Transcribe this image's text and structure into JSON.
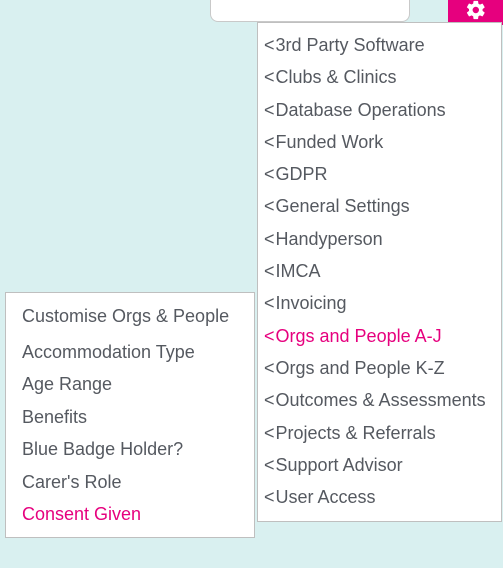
{
  "top_input": {
    "value": ""
  },
  "gear": {
    "icon_name": "gear-icon"
  },
  "main_menu": {
    "items": [
      {
        "label": "3rd Party Software",
        "active": false
      },
      {
        "label": "Clubs & Clinics",
        "active": false
      },
      {
        "label": "Database Operations",
        "active": false
      },
      {
        "label": "Funded Work",
        "active": false
      },
      {
        "label": "GDPR",
        "active": false
      },
      {
        "label": "General Settings",
        "active": false
      },
      {
        "label": "Handyperson",
        "active": false
      },
      {
        "label": "IMCA",
        "active": false
      },
      {
        "label": "Invoicing",
        "active": false
      },
      {
        "label": "Orgs and People A-J",
        "active": true
      },
      {
        "label": "Orgs and People K-Z",
        "active": false
      },
      {
        "label": "Outcomes & Assessments",
        "active": false
      },
      {
        "label": "Projects & Referrals",
        "active": false
      },
      {
        "label": "Support Advisor",
        "active": false
      },
      {
        "label": "User Access",
        "active": false
      }
    ]
  },
  "sub_menu": {
    "header": "Customise Orgs & People",
    "items": [
      {
        "label": "Accommodation Type",
        "active": false
      },
      {
        "label": "Age Range",
        "active": false
      },
      {
        "label": "Benefits",
        "active": false
      },
      {
        "label": "Blue Badge Holder?",
        "active": false
      },
      {
        "label": "Carer's Role",
        "active": false
      },
      {
        "label": "Consent Given",
        "active": true
      }
    ]
  },
  "colors": {
    "accent": "#e6007e",
    "text": "#555960",
    "bg_page": "#d9f0f0",
    "panel_border": "#bfbfbf"
  }
}
